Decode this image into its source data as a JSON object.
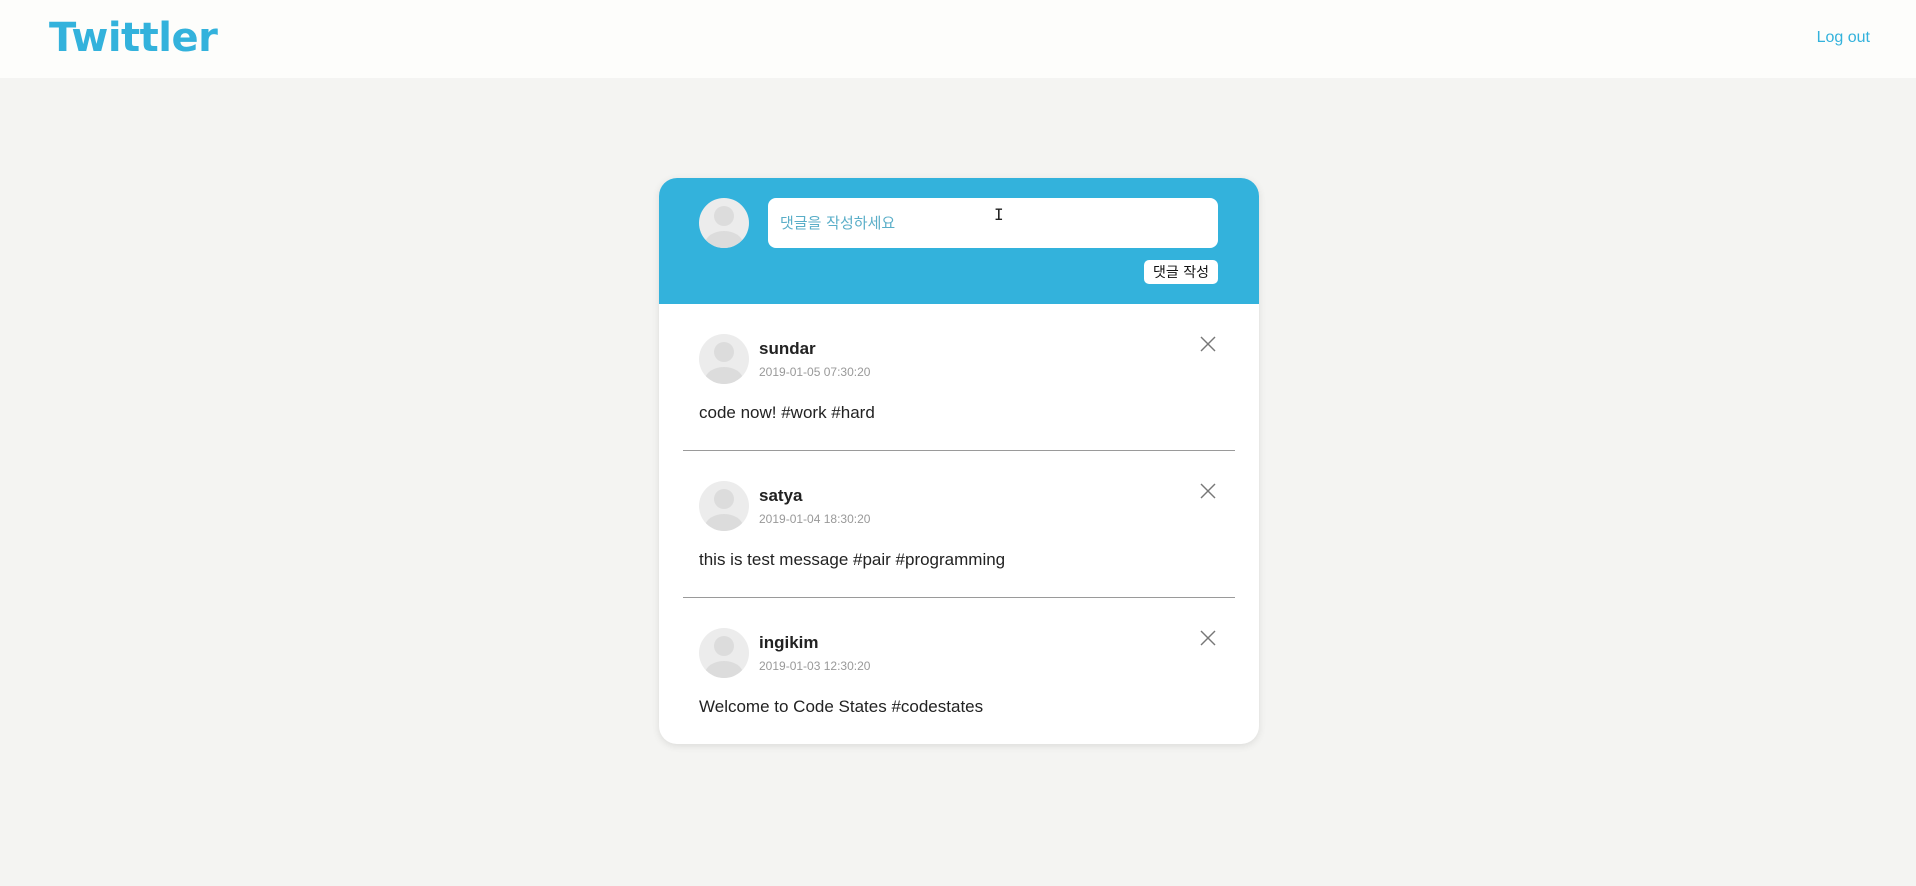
{
  "header": {
    "logo": "Twittler",
    "logout_label": "Log out"
  },
  "composer": {
    "placeholder": "댓글을 작성하세요",
    "submit_label": "댓글 작성"
  },
  "tweets": [
    {
      "username": "sundar",
      "timestamp": "2019-01-05 07:30:20",
      "message": "code now! #work #hard"
    },
    {
      "username": "satya",
      "timestamp": "2019-01-04 18:30:20",
      "message": "this is test message #pair #programming"
    },
    {
      "username": "ingikim",
      "timestamp": "2019-01-03 12:30:20",
      "message": "Welcome to Code States #codestates"
    }
  ],
  "icons": {
    "avatar": "user-avatar-icon",
    "delete": "close-icon",
    "cursor": "text-cursor-icon"
  },
  "colors": {
    "accent": "#33b2dc",
    "page_background": "#f4f4f2",
    "card_background": "#ffffff"
  }
}
